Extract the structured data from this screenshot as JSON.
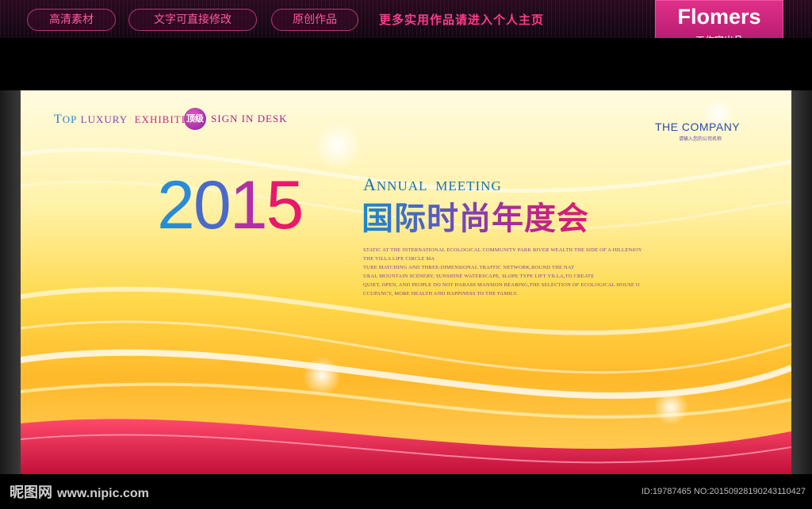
{
  "topbar": {
    "pills": [
      "高清素材",
      "文字可直接修改",
      "原创作品"
    ],
    "promo": "更多实用作品请进入个人主页"
  },
  "badge": {
    "title": "Flomers",
    "subtitle": "工作室出品"
  },
  "poster": {
    "tagline_left": [
      "T",
      "OP",
      " ",
      "LUXURY",
      " ",
      "EXHIBITION"
    ],
    "tag_badge": "顶级",
    "tagline_right": [
      "S",
      "IGN",
      " ",
      "IN",
      " ",
      "DESK"
    ],
    "company": "THE COMPANY",
    "company_sub": "请输入您的公司名称",
    "year": [
      "2",
      "0",
      "1",
      "5"
    ],
    "annual_cap": "A",
    "annual_rest": "NNUAL  MEETING",
    "cn_title": "国际时尚年度会",
    "desc_lines": [
      "STATIC AT THE INTERNATIONAL ECOLOGICAL COMMUNITY PARK RIVER WEALTH THE SIDE OF A HILLENJOY",
      "THE VILLA LIFE CIRCLE MA",
      "TURE MATCHING AND THREE-DIMENSIONAL TRAFFIC NETWORK,ROUND THE NAT",
      "URAL MOUNTAIN SCENERY, SUNSHINE WATERSCAPE, SLOPE TYPE LIFT VILLA,TO CREATE",
      "QUIET, OPEN, AND PEOPLE DO NOT HARASS MANSION BEARING,THE SELECTION OF ECOLOGICAL HOUSE O",
      "CCUPANCY, MORE HEALTH AND HAPPINESS TO THE FAMILY."
    ]
  },
  "footer": {
    "logo": "昵图网",
    "url": "www.nipic.com",
    "id_text": "ID:19787465 NO:20150928190243110427"
  },
  "colors": {
    "year_digits": [
      "#2a8ad8",
      "#4a6ac8",
      "#b030a8",
      "#e8186a"
    ],
    "accent_pink": "#ff3a8a"
  }
}
